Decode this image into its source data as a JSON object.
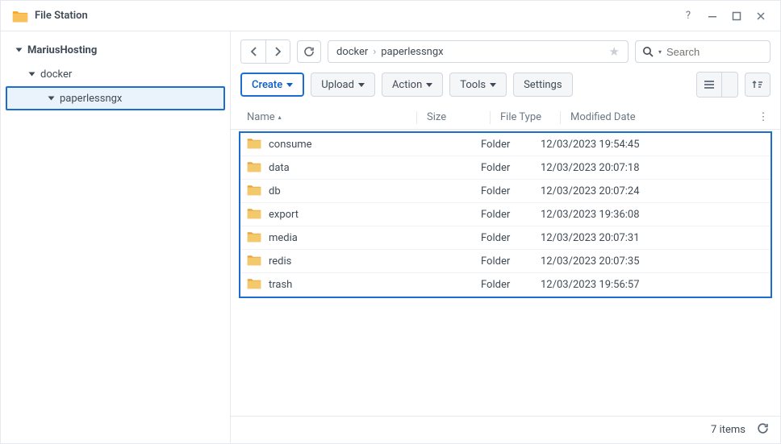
{
  "app": {
    "title": "File Station"
  },
  "tree": {
    "root": "MariusHosting",
    "l1": "docker",
    "l2": "paperlessngx"
  },
  "breadcrumb": [
    "docker",
    "paperlessngx"
  ],
  "search": {
    "placeholder": "Search"
  },
  "buttons": {
    "create": "Create",
    "upload": "Upload",
    "action": "Action",
    "tools": "Tools",
    "settings": "Settings"
  },
  "columns": {
    "name": "Name",
    "size": "Size",
    "type": "File Type",
    "date": "Modified Date"
  },
  "files": [
    {
      "name": "consume",
      "size": "",
      "type": "Folder",
      "date": "12/03/2023 19:54:45"
    },
    {
      "name": "data",
      "size": "",
      "type": "Folder",
      "date": "12/03/2023 20:07:18"
    },
    {
      "name": "db",
      "size": "",
      "type": "Folder",
      "date": "12/03/2023 20:07:24"
    },
    {
      "name": "export",
      "size": "",
      "type": "Folder",
      "date": "12/03/2023 19:36:08"
    },
    {
      "name": "media",
      "size": "",
      "type": "Folder",
      "date": "12/03/2023 20:07:31"
    },
    {
      "name": "redis",
      "size": "",
      "type": "Folder",
      "date": "12/03/2023 20:07:35"
    },
    {
      "name": "trash",
      "size": "",
      "type": "Folder",
      "date": "12/03/2023 19:56:57"
    }
  ],
  "footer": {
    "count": "7 items"
  }
}
